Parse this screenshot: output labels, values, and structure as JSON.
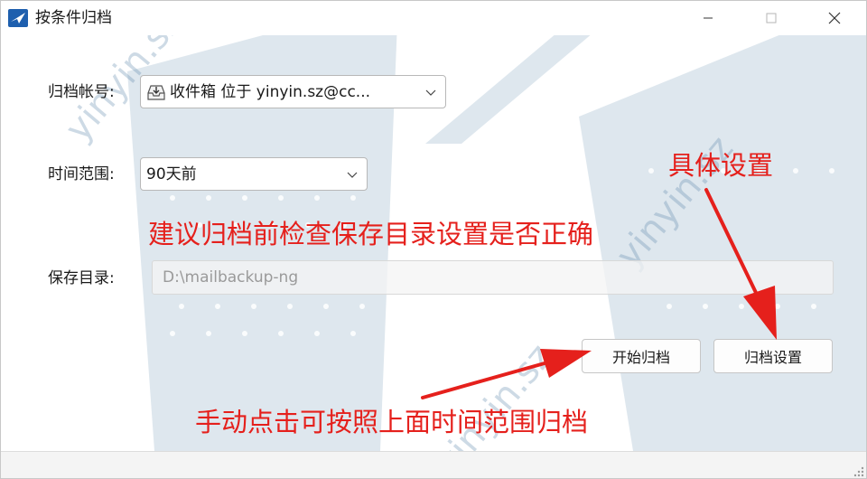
{
  "window": {
    "title": "按条件归档",
    "icon": "app-logo-icon",
    "controls": [
      "minimize-icon",
      "maximize-icon",
      "close-icon"
    ]
  },
  "watermark": {
    "texts": [
      "yinyin.sz",
      "yinyin.sz",
      "yinyin.sz"
    ],
    "color": "#5a86a8"
  },
  "form": {
    "account_label": "归档帐号:",
    "account_value": "收件箱 位于 yinyin.sz@cc...",
    "account_icon": "inbox-download-icon",
    "range_label": "时间范围:",
    "range_value": "90天前",
    "dir_label": "保存目录:",
    "dir_value": "D:\\mailbackup-ng"
  },
  "buttons": {
    "start_label": "开始归档",
    "settings_label": "归档设置"
  },
  "annotations": {
    "detail_settings": "具体设置",
    "check_dir": "建议归档前检查保存目录设置是否正确",
    "manual_archive": "手动点击可按照上面时间范围归档",
    "color": "#e5201c"
  }
}
